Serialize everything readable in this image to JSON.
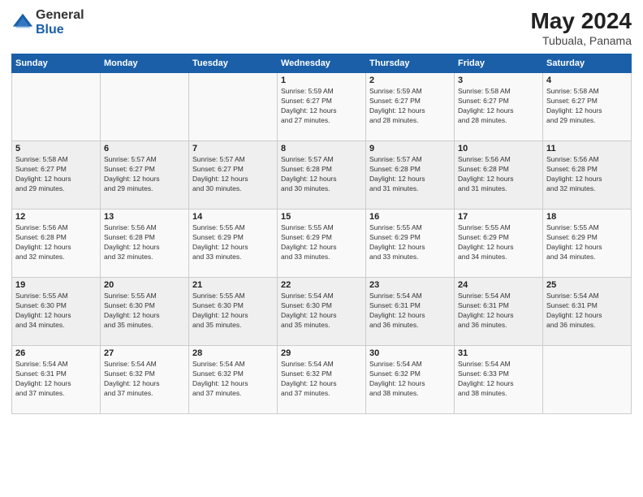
{
  "logo": {
    "general": "General",
    "blue": "Blue"
  },
  "header": {
    "month": "May 2024",
    "location": "Tubuala, Panama"
  },
  "weekdays": [
    "Sunday",
    "Monday",
    "Tuesday",
    "Wednesday",
    "Thursday",
    "Friday",
    "Saturday"
  ],
  "weeks": [
    [
      {
        "day": "",
        "info": ""
      },
      {
        "day": "",
        "info": ""
      },
      {
        "day": "",
        "info": ""
      },
      {
        "day": "1",
        "info": "Sunrise: 5:59 AM\nSunset: 6:27 PM\nDaylight: 12 hours\nand 27 minutes."
      },
      {
        "day": "2",
        "info": "Sunrise: 5:59 AM\nSunset: 6:27 PM\nDaylight: 12 hours\nand 28 minutes."
      },
      {
        "day": "3",
        "info": "Sunrise: 5:58 AM\nSunset: 6:27 PM\nDaylight: 12 hours\nand 28 minutes."
      },
      {
        "day": "4",
        "info": "Sunrise: 5:58 AM\nSunset: 6:27 PM\nDaylight: 12 hours\nand 29 minutes."
      }
    ],
    [
      {
        "day": "5",
        "info": "Sunrise: 5:58 AM\nSunset: 6:27 PM\nDaylight: 12 hours\nand 29 minutes."
      },
      {
        "day": "6",
        "info": "Sunrise: 5:57 AM\nSunset: 6:27 PM\nDaylight: 12 hours\nand 29 minutes."
      },
      {
        "day": "7",
        "info": "Sunrise: 5:57 AM\nSunset: 6:27 PM\nDaylight: 12 hours\nand 30 minutes."
      },
      {
        "day": "8",
        "info": "Sunrise: 5:57 AM\nSunset: 6:28 PM\nDaylight: 12 hours\nand 30 minutes."
      },
      {
        "day": "9",
        "info": "Sunrise: 5:57 AM\nSunset: 6:28 PM\nDaylight: 12 hours\nand 31 minutes."
      },
      {
        "day": "10",
        "info": "Sunrise: 5:56 AM\nSunset: 6:28 PM\nDaylight: 12 hours\nand 31 minutes."
      },
      {
        "day": "11",
        "info": "Sunrise: 5:56 AM\nSunset: 6:28 PM\nDaylight: 12 hours\nand 32 minutes."
      }
    ],
    [
      {
        "day": "12",
        "info": "Sunrise: 5:56 AM\nSunset: 6:28 PM\nDaylight: 12 hours\nand 32 minutes."
      },
      {
        "day": "13",
        "info": "Sunrise: 5:56 AM\nSunset: 6:28 PM\nDaylight: 12 hours\nand 32 minutes."
      },
      {
        "day": "14",
        "info": "Sunrise: 5:55 AM\nSunset: 6:29 PM\nDaylight: 12 hours\nand 33 minutes."
      },
      {
        "day": "15",
        "info": "Sunrise: 5:55 AM\nSunset: 6:29 PM\nDaylight: 12 hours\nand 33 minutes."
      },
      {
        "day": "16",
        "info": "Sunrise: 5:55 AM\nSunset: 6:29 PM\nDaylight: 12 hours\nand 33 minutes."
      },
      {
        "day": "17",
        "info": "Sunrise: 5:55 AM\nSunset: 6:29 PM\nDaylight: 12 hours\nand 34 minutes."
      },
      {
        "day": "18",
        "info": "Sunrise: 5:55 AM\nSunset: 6:29 PM\nDaylight: 12 hours\nand 34 minutes."
      }
    ],
    [
      {
        "day": "19",
        "info": "Sunrise: 5:55 AM\nSunset: 6:30 PM\nDaylight: 12 hours\nand 34 minutes."
      },
      {
        "day": "20",
        "info": "Sunrise: 5:55 AM\nSunset: 6:30 PM\nDaylight: 12 hours\nand 35 minutes."
      },
      {
        "day": "21",
        "info": "Sunrise: 5:55 AM\nSunset: 6:30 PM\nDaylight: 12 hours\nand 35 minutes."
      },
      {
        "day": "22",
        "info": "Sunrise: 5:54 AM\nSunset: 6:30 PM\nDaylight: 12 hours\nand 35 minutes."
      },
      {
        "day": "23",
        "info": "Sunrise: 5:54 AM\nSunset: 6:31 PM\nDaylight: 12 hours\nand 36 minutes."
      },
      {
        "day": "24",
        "info": "Sunrise: 5:54 AM\nSunset: 6:31 PM\nDaylight: 12 hours\nand 36 minutes."
      },
      {
        "day": "25",
        "info": "Sunrise: 5:54 AM\nSunset: 6:31 PM\nDaylight: 12 hours\nand 36 minutes."
      }
    ],
    [
      {
        "day": "26",
        "info": "Sunrise: 5:54 AM\nSunset: 6:31 PM\nDaylight: 12 hours\nand 37 minutes."
      },
      {
        "day": "27",
        "info": "Sunrise: 5:54 AM\nSunset: 6:32 PM\nDaylight: 12 hours\nand 37 minutes."
      },
      {
        "day": "28",
        "info": "Sunrise: 5:54 AM\nSunset: 6:32 PM\nDaylight: 12 hours\nand 37 minutes."
      },
      {
        "day": "29",
        "info": "Sunrise: 5:54 AM\nSunset: 6:32 PM\nDaylight: 12 hours\nand 37 minutes."
      },
      {
        "day": "30",
        "info": "Sunrise: 5:54 AM\nSunset: 6:32 PM\nDaylight: 12 hours\nand 38 minutes."
      },
      {
        "day": "31",
        "info": "Sunrise: 5:54 AM\nSunset: 6:33 PM\nDaylight: 12 hours\nand 38 minutes."
      },
      {
        "day": "",
        "info": ""
      }
    ]
  ]
}
